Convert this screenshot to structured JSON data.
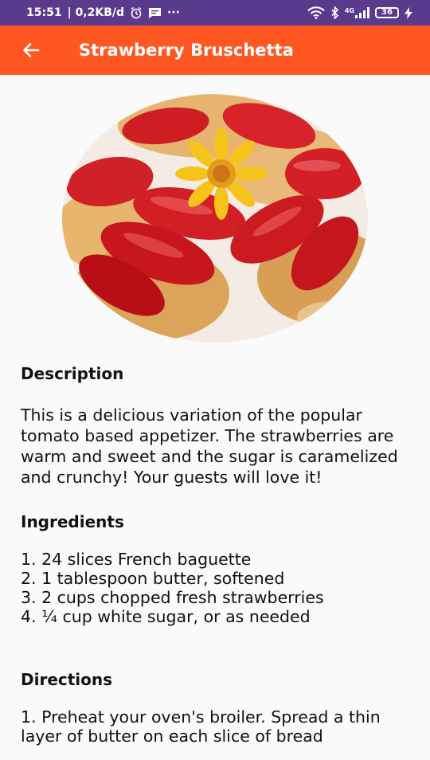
{
  "status_bar": {
    "time": "15:51",
    "network_speed": "| 0,2KB/d",
    "more": "···",
    "network_type": "4G",
    "battery": "36"
  },
  "app_bar": {
    "back_icon": "arrow-back-icon",
    "title": "Strawberry Bruschetta"
  },
  "recipe": {
    "image": "strawberry-bruschetta-photo",
    "description_heading": "Description",
    "description": "This is a delicious variation of the popular tomato based appetizer. The strawberries are warm and sweet and the sugar is caramelized and crunchy! Your guests will love it!",
    "ingredients_heading": "Ingredients",
    "ingredients": [
      "1. 24 slices French baguette",
      "2. 1 tablespoon butter, softened",
      "3. 2 cups chopped fresh strawberries",
      "4. ¼ cup white sugar, or as needed"
    ],
    "directions_heading": "Directions",
    "directions": "1. Preheat your oven's broiler. Spread a thin layer of butter on each slice of bread"
  },
  "colors": {
    "status_bar": "#5a3a8c",
    "app_bar": "#ff5722",
    "background": "#fafafa"
  }
}
